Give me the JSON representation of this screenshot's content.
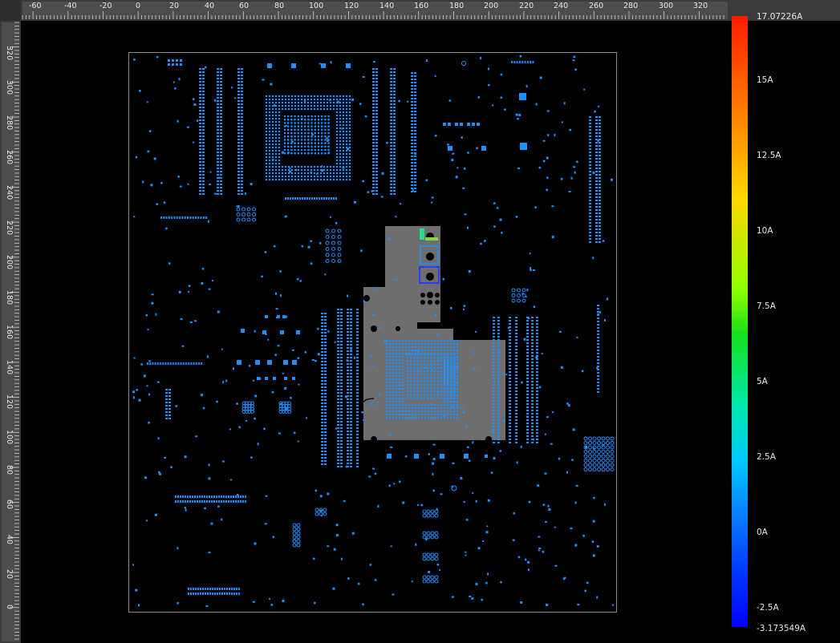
{
  "ruler_x": {
    "labels": [
      "-60",
      "-40",
      "-20",
      "0",
      "20",
      "40",
      "60",
      "80",
      "100",
      "120",
      "140",
      "160",
      "180",
      "200",
      "220",
      "240",
      "260",
      "280",
      "300",
      "320"
    ]
  },
  "ruler_y": {
    "labels": [
      "320",
      "300",
      "280",
      "260",
      "240",
      "220",
      "200",
      "180",
      "160",
      "140",
      "120",
      "100",
      "80",
      "60",
      "40",
      "20",
      "0"
    ]
  },
  "colorbar": {
    "max_label": "17.07226A",
    "min_label": "-3.173549A",
    "ticks": [
      "15A",
      "12.5A",
      "10A",
      "7.5A",
      "5A",
      "2.5A",
      "0A",
      "-2.5A"
    ]
  },
  "colors": {
    "background": "#000000",
    "ruler": "#4d4d4d",
    "copper_plane": "#6e6e6e",
    "pad_blue": "#1f8fff",
    "via_black": "#000000",
    "board_outline": "#8a8a8a"
  }
}
